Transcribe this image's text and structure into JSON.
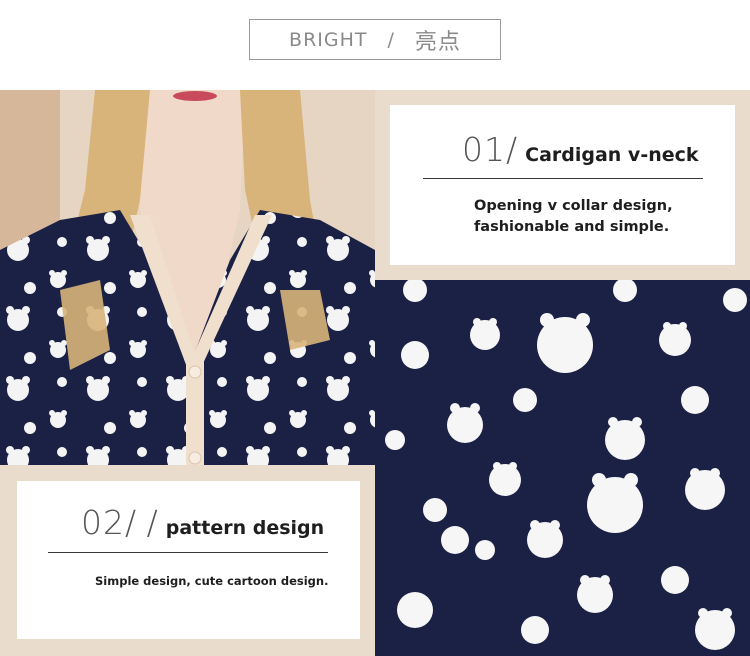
{
  "header": {
    "title_en": "BRIGHT",
    "separator": "/",
    "title_cn": "亮点"
  },
  "feature_1": {
    "number": "01",
    "slash": "/",
    "title": "Cardigan v-neck",
    "desc_line1": "Opening v collar design,",
    "desc_line2": "fashionable and simple."
  },
  "feature_2": {
    "number": "02",
    "slash": "/ /",
    "title": "pattern design",
    "desc": "Simple design, cute cartoon design."
  },
  "colors": {
    "beige": "#e9dccd",
    "navy": "#1b2045",
    "collar": "#efdfcc",
    "hair": "#d9b47a",
    "text": "#1e1e1e"
  }
}
